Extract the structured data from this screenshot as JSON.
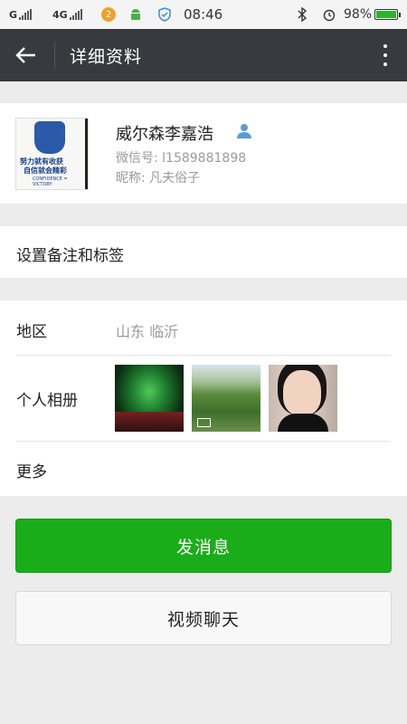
{
  "status_bar": {
    "sim1_label": "G",
    "sim2_label": "4G",
    "notification_count": "2",
    "time": "08:46",
    "battery_percent": "98%",
    "battery_level": 0.98
  },
  "header": {
    "title": "详细资料",
    "icons": [
      "back-arrow-icon",
      "more-vertical-icon"
    ]
  },
  "profile": {
    "name": "威尔森李嘉浩",
    "wechat_id": "微信号: l1589881898",
    "nickname": "昵称: 凡夫俗子",
    "avatar_text": [
      "努力就有收获",
      "自信就会精彩",
      "CONFIDENCE = VICTORY"
    ]
  },
  "remark": {
    "label": "设置备注和标签"
  },
  "details": {
    "region_label": "地区",
    "region_value": "山东  临沂",
    "album_label": "个人相册",
    "more_label": "更多"
  },
  "actions": {
    "send_message": "发消息",
    "video_call": "视频聊天"
  },
  "colors": {
    "title_bar": "#393a3f",
    "primary_button": "#1aad19",
    "page_background": "#ececec"
  }
}
